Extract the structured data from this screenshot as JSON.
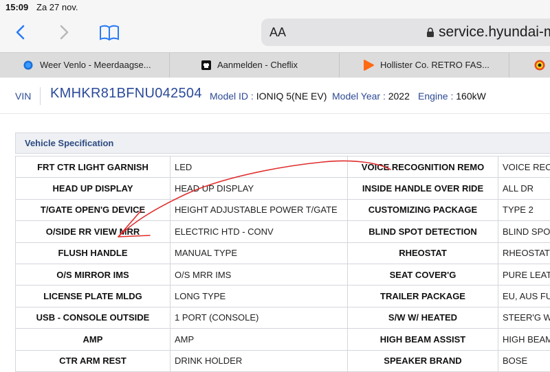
{
  "status": {
    "time": "15:09",
    "date": "Za 27 nov."
  },
  "browser": {
    "text_size_button": "AA",
    "url": "service.hyundai-mo",
    "tabs": [
      {
        "label": "Weer Venlo - Meerdaagse...",
        "icon": "weather-favicon"
      },
      {
        "label": "Aanmelden - Cheflix",
        "icon": "cheflix-favicon"
      },
      {
        "label": "Hollister Co. RETRO FAS...",
        "icon": "hollister-favicon"
      },
      {
        "label": "",
        "icon": "site-favicon"
      }
    ]
  },
  "vehicle": {
    "vin_label": "VIN",
    "vin": "KMHKR81BFNU042504",
    "model_id_label": "Model ID :",
    "model_id": "IONIQ 5(NE EV)",
    "model_year_label": "Model Year :",
    "model_year": "2022",
    "engine_label": "Engine :",
    "engine": "160kW"
  },
  "spec": {
    "title": "Vehicle Specification",
    "rows": [
      [
        "FRT CTR LIGHT GARNISH",
        "LED",
        "VOICE RECOGNITION REMO",
        "VOICE REC"
      ],
      [
        "HEAD UP DISPLAY",
        "HEAD UP DISPLAY",
        "INSIDE HANDLE OVER RIDE",
        "ALL DR"
      ],
      [
        "T/GATE OPEN'G DEVICE",
        "HEIGHT ADJUSTABLE POWER T/GATE",
        "CUSTOMIZING PACKAGE",
        "TYPE 2"
      ],
      [
        "O/SIDE RR VIEW MRR",
        "ELECTRIC HTD - CONV",
        "BLIND SPOT DETECTION",
        "BLIND SPO"
      ],
      [
        "FLUSH HANDLE",
        "MANUAL TYPE",
        "RHEOSTAT",
        "RHEOSTAT"
      ],
      [
        "O/S MIRROR IMS",
        "O/S MRR IMS",
        "SEAT COVER'G",
        "PURE LEAT"
      ],
      [
        "LICENSE PLATE MLDG",
        "LONG TYPE",
        "TRAILER PACKAGE",
        "EU, AUS FU"
      ],
      [
        "USB - CONSOLE OUTSIDE",
        "1 PORT (CONSOLE)",
        "S/W W/ HEATED",
        "STEER'G W"
      ],
      [
        "AMP",
        "AMP",
        "HIGH BEAM ASSIST",
        "HIGH BEAM"
      ],
      [
        "CTR ARM REST",
        "DRINK HOLDER",
        "SPEAKER BRAND",
        "BOSE"
      ]
    ]
  },
  "colors": {
    "accent": "#2c4a94",
    "annotation": "#e02b2b"
  }
}
